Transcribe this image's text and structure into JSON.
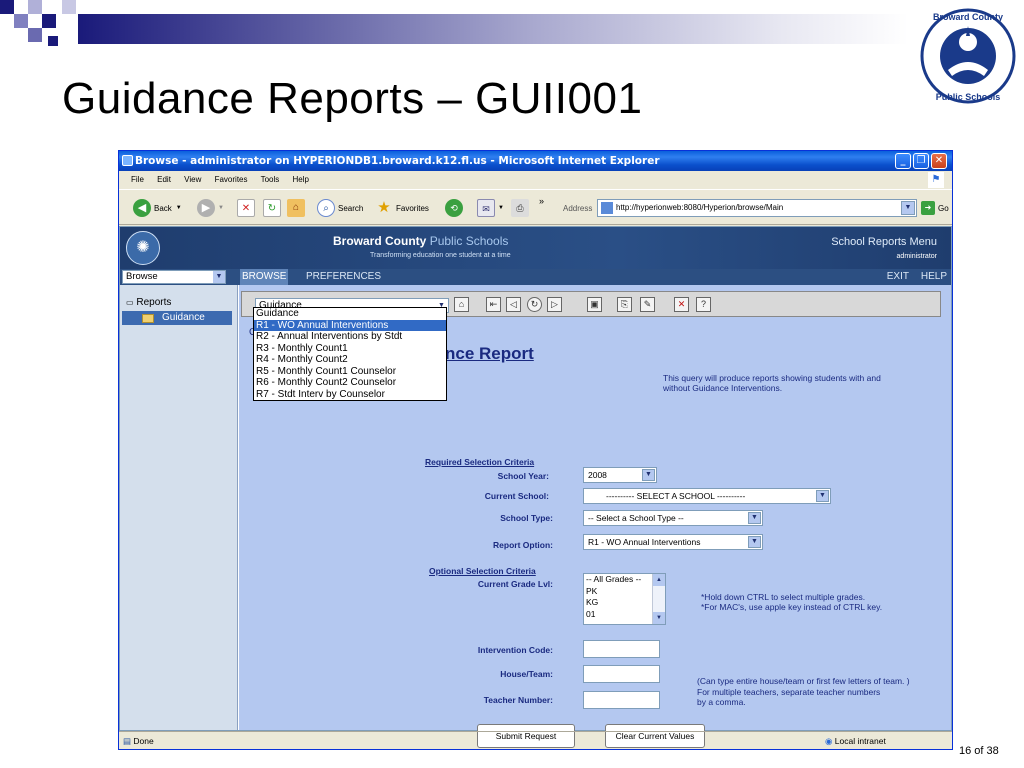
{
  "slide": {
    "title": "Guidance Reports – GUII001",
    "page_number": "16 of 38",
    "logo_text": "Broward County Public Schools"
  },
  "browser": {
    "title": "Browse - administrator on HYPERIONDB1.broward.k12.fl.us - Microsoft Internet Explorer",
    "menu": [
      "File",
      "Edit",
      "View",
      "Favorites",
      "Tools",
      "Help"
    ],
    "toolbar": {
      "back": "Back",
      "search": "Search",
      "favorites": "Favorites",
      "address_label": "Address",
      "address": "http://hyperionweb:8080/Hyperion/browse/Main",
      "go": "Go"
    },
    "status": "Done",
    "zone": "Local intranet"
  },
  "app": {
    "org_name_bold": "Broward County",
    "org_name_light": "Public Schools",
    "tagline": "Transforming education one student at a time",
    "menu_title": "School Reports Menu",
    "user": "administrator",
    "nav": {
      "browse_select": "Browse",
      "browse": "BROWSE",
      "preferences": "PREFERENCES",
      "exit": "EXIT",
      "help": "HELP"
    },
    "tree": {
      "root": "Reports",
      "child": "Guidance"
    }
  },
  "report": {
    "selector_value": "Guidance",
    "dropdown_options": [
      "Guidance",
      "R1 - WO Annual Interventions",
      "R2 - Annual Interventions by Stdt",
      "R3 - Monthly Count1",
      "R4 - Monthly Count2",
      "R5 - Monthly Count1 Counselor",
      "R6 - Monthly Count2 Counselor",
      "R7 - Stdt  Interv by Counselor"
    ],
    "dropdown_selected_index": 1,
    "title_fragment": "nce Report",
    "title_leading": "G",
    "description": "This query will produce reports showing students with and without Guidance Interventions.",
    "required_label": "Required Selection Criteria",
    "fields": {
      "school_year_label": "School Year:",
      "school_year_value": "2008",
      "current_school_label": "Current School:",
      "current_school_value": "---------- SELECT A SCHOOL ----------",
      "school_type_label": "School Type:",
      "school_type_value": "-- Select a School Type --",
      "report_option_label": "Report Option:",
      "report_option_value": "R1 - WO Annual Interventions"
    },
    "optional_label": "Optional Selection Criteria",
    "grade_label": "Current Grade Lvl:",
    "grades": [
      "-- All Grades --",
      "PK",
      "KG",
      "01"
    ],
    "grade_note_1": "*Hold down CTRL to select multiple grades.",
    "grade_note_2": "*For MAC's, use apple key instead of CTRL key.",
    "intervention_code_label": "Intervention Code:",
    "house_team_label": "House/Team:",
    "teacher_number_label": "Teacher Number:",
    "house_note_1": "(Can type entire house/team or first few letters of team. )",
    "teacher_note_1": "For multiple teachers, separate teacher numbers",
    "teacher_note_2": "by a comma.",
    "submit": "Submit Request",
    "clear": "Clear Current Values"
  }
}
